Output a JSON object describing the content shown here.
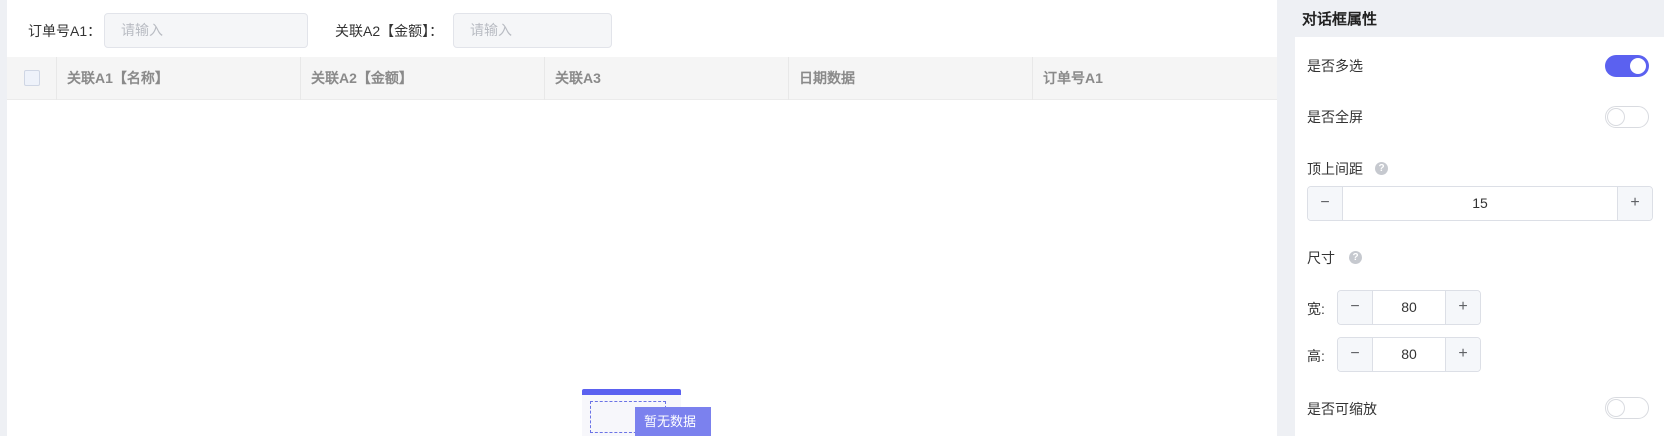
{
  "filters": [
    {
      "label": "订单号A1：",
      "placeholder": "请输入"
    },
    {
      "label": "关联A2【金额】：",
      "placeholder": "请输入"
    }
  ],
  "table": {
    "columns": [
      "关联A1【名称】",
      "关联A2【金额】",
      "关联A3",
      "日期数据",
      "订单号A1"
    ],
    "empty_text": "暂无数据"
  },
  "panel": {
    "title": "对话框属性",
    "multi_select": {
      "label": "是否多选",
      "on": true
    },
    "fullscreen": {
      "label": "是否全屏",
      "on": false
    },
    "top_margin": {
      "label": "顶上间距",
      "value": "15"
    },
    "size": {
      "label": "尺寸",
      "width_label": "宽:",
      "width": "80",
      "height_label": "高:",
      "height": "80"
    },
    "resizable": {
      "label": "是否可缩放",
      "on": false
    }
  },
  "colors": {
    "accent": "#5b61f0"
  },
  "icons": {
    "help": "question-circle-icon",
    "minus": "minus-icon",
    "plus": "plus-icon"
  }
}
